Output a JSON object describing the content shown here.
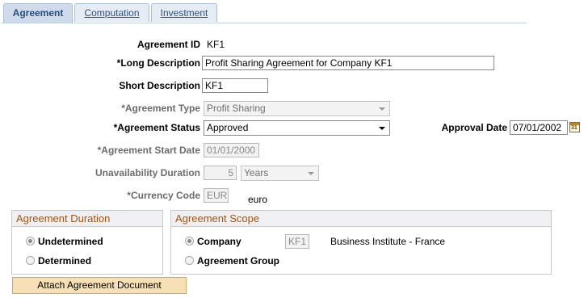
{
  "tabs": [
    {
      "label": "Agreement",
      "active": true
    },
    {
      "label": "Computation",
      "active": false
    },
    {
      "label": "Investment",
      "active": false
    }
  ],
  "form": {
    "agreement_id": {
      "label": "Agreement ID",
      "value": "KF1"
    },
    "long_description": {
      "label": "*Long Description",
      "value": "Profit Sharing Agreement for Company KF1"
    },
    "short_description": {
      "label": "Short Description",
      "value": "KF1"
    },
    "agreement_type": {
      "label": "*Agreement Type",
      "value": "Profit Sharing"
    },
    "agreement_status": {
      "label": "*Agreement Status",
      "value": "Approved"
    },
    "approval_date": {
      "label": "Approval Date",
      "value": "07/01/2002"
    },
    "start_date": {
      "label": "*Agreement Start Date",
      "value": "01/01/2000"
    },
    "unavailability": {
      "label": "Unavailability Duration",
      "value": "5",
      "unit": "Years"
    },
    "currency": {
      "label": "*Currency Code",
      "value": "EUR",
      "description": "euro"
    }
  },
  "duration_group": {
    "title": "Agreement Duration",
    "options": [
      {
        "label": "Undetermined",
        "selected": true
      },
      {
        "label": "Determined",
        "selected": false
      }
    ]
  },
  "scope_group": {
    "title": "Agreement Scope",
    "company": {
      "label": "Company",
      "selected": true,
      "code": "KF1",
      "name": "Business Institute - France"
    },
    "group": {
      "label": "Agreement Group",
      "selected": false
    }
  },
  "attach_button": "Attach Agreement Document",
  "icons": {
    "calendar": "calendar-icon",
    "dropdown": "chevron-down-icon"
  }
}
